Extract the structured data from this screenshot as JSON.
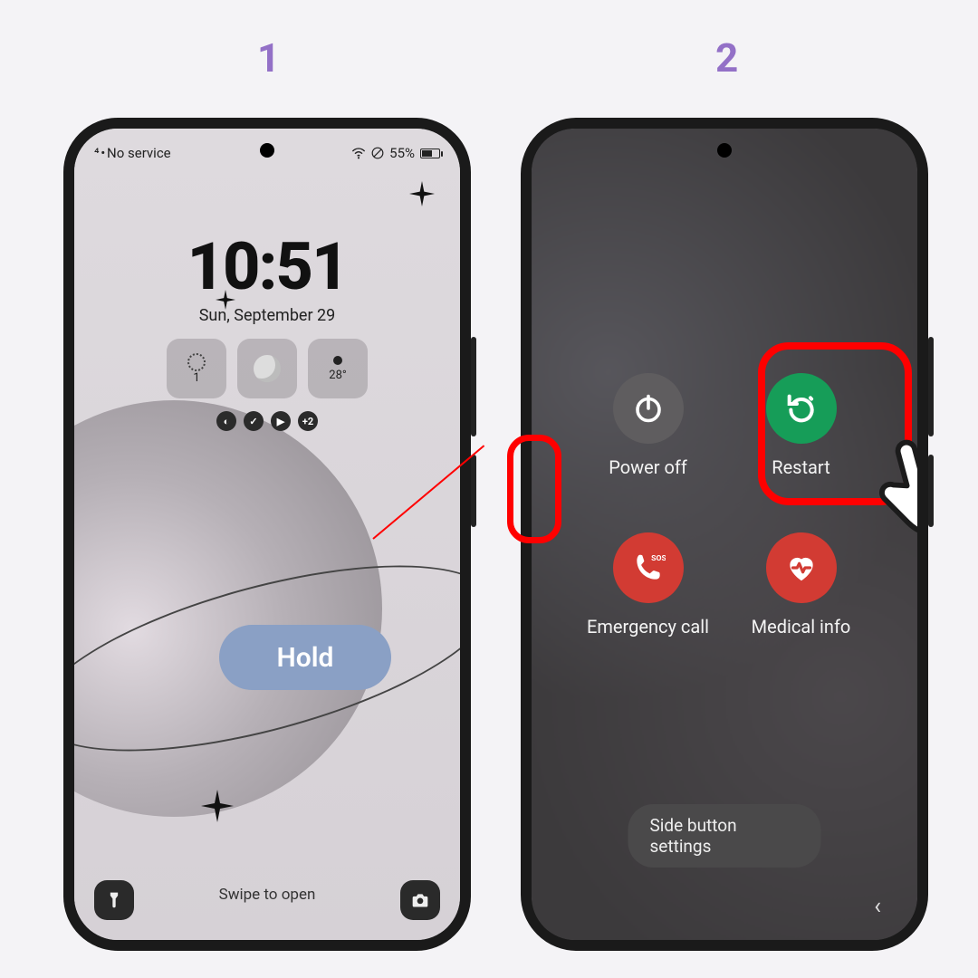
{
  "steps": {
    "one": "1",
    "two": "2"
  },
  "colors": {
    "accent_purple": "#9370c7",
    "annotation_red": "#ff0000",
    "hold_pill": "#8aa0c5",
    "restart_green": "#169d58",
    "danger_red": "#d23b33",
    "neutral_button": "#5f5d5f"
  },
  "step1": {
    "statusbar": {
      "service": "No service",
      "battery_pct": "55%",
      "wifi_icon": "wifi-icon",
      "no_sim_icon": "no-sim-icon"
    },
    "clock": "10:51",
    "date": "Sun, September 29",
    "widgets": {
      "uv": {
        "value": "1",
        "icon": "sun-icon"
      },
      "moon": {
        "icon": "moon-icon"
      },
      "temp": {
        "value": "28°",
        "icon": "dot-icon"
      }
    },
    "notif_badge": "+2",
    "swipe_hint": "Swipe to open",
    "corner_buttons": {
      "torch": "flashlight-icon",
      "camera": "camera-icon"
    },
    "annotation": {
      "hold_label": "Hold",
      "target": "power-button"
    }
  },
  "step2": {
    "options": [
      {
        "key": "power_off",
        "label": "Power off",
        "color": "grey",
        "icon": "power-icon"
      },
      {
        "key": "restart",
        "label": "Restart",
        "color": "green",
        "icon": "restart-icon"
      },
      {
        "key": "emergency",
        "label": "Emergency call",
        "color": "red",
        "icon": "phone-sos-icon"
      },
      {
        "key": "medical",
        "label": "Medical info",
        "color": "red",
        "icon": "heart-pulse-icon"
      }
    ],
    "side_button_settings": "Side button settings",
    "back": "‹",
    "annotation": {
      "highlighted": "restart",
      "cursor": "pointer-hand-icon"
    }
  }
}
